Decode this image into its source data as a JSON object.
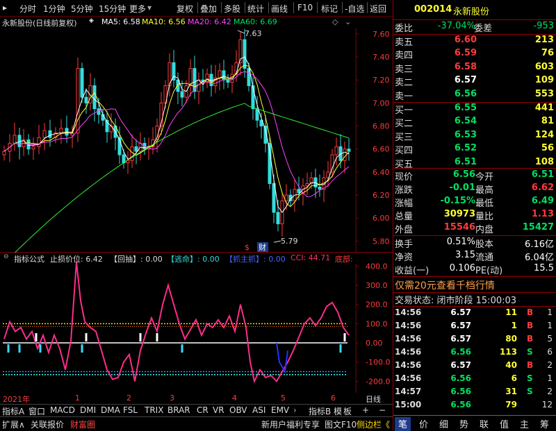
{
  "toolbar": {
    "left_items": [
      "分时",
      "1分钟",
      "5分钟",
      "15分钟",
      "更多"
    ],
    "right_items": [
      "复权",
      "叠加",
      "多股",
      "统计",
      "画线",
      "F10",
      "标记",
      "-自选",
      "返回"
    ]
  },
  "main_legend": {
    "title": "永新股份(日线前复权)",
    "ma5": "MA5: 6.58",
    "ma10": "MA10: 6.56",
    "ma20": "MA20: 6.42",
    "ma60": "MA60: 6.69",
    "high_label": "7.63",
    "low_label": "5.79",
    "marker_money": "$",
    "marker_fin": "财"
  },
  "price_axis": [
    "7.60",
    "7.40",
    "7.20",
    "7.00",
    "6.80",
    "6.60",
    "6.40",
    "6.20",
    "6.00",
    "5.80"
  ],
  "indicator_legend": {
    "name": "指标公式",
    "stop": "止损价位: 6.42",
    "huichou": "【回抽】: 0.00",
    "taoming": "【逃命】: 0.00",
    "dianzhu": "【抓主抓】: 0.00",
    "cci": "CCI: 44.71",
    "dibu": "底部:"
  },
  "indicator_axis": [
    "400.0",
    "300.0",
    "200.0",
    "100.0",
    "0.00",
    "-100.0",
    "-200.0"
  ],
  "time_axis": {
    "labels": [
      "2021年",
      "1",
      "2",
      "3",
      "4",
      "5",
      "6"
    ],
    "right_label": "日线"
  },
  "indicator_tabs": [
    "指标A",
    "窗口",
    "MACD",
    "DMI",
    "DMA",
    "FSL",
    "TRIX",
    "BRAR",
    "CR",
    "VR",
    "OBV",
    "ASI",
    "EMV",
    "指标B",
    "模",
    "板"
  ],
  "bottom_tabs": [
    "扩展∧",
    "关联报价",
    "财富圈",
    "新用户福利专享",
    "图文F10",
    "侧边栏《"
  ],
  "quote": {
    "code": "002014",
    "name": "永新股份",
    "weibi_label": "委比",
    "weibi": "-37.04%",
    "weicha_label": "委差",
    "weicha": "-953",
    "asks": [
      {
        "label": "卖五",
        "price": "6.60",
        "vol": "213"
      },
      {
        "label": "卖四",
        "price": "6.59",
        "vol": "76"
      },
      {
        "label": "卖三",
        "price": "6.58",
        "vol": "603"
      },
      {
        "label": "卖二",
        "price": "6.57",
        "vol": "109"
      },
      {
        "label": "卖一",
        "price": "6.56",
        "vol": "553"
      }
    ],
    "bids": [
      {
        "label": "买一",
        "price": "6.55",
        "vol": "441"
      },
      {
        "label": "买二",
        "price": "6.54",
        "vol": "81"
      },
      {
        "label": "买三",
        "price": "6.53",
        "vol": "124"
      },
      {
        "label": "买四",
        "price": "6.52",
        "vol": "56"
      },
      {
        "label": "买五",
        "price": "6.51",
        "vol": "108"
      }
    ],
    "stats": [
      {
        "l1": "现价",
        "v1": "6.56",
        "l2": "今开",
        "v2": "6.51"
      },
      {
        "l1": "涨跌",
        "v1": "-0.01",
        "l2": "最高",
        "v2": "6.62"
      },
      {
        "l1": "涨幅",
        "v1": "-0.15%",
        "l2": "最低",
        "v2": "6.49"
      },
      {
        "l1": "总量",
        "v1": "30973",
        "l2": "量比",
        "v2": "1.13"
      },
      {
        "l1": "外盘",
        "v1": "15546",
        "l2": "内盘",
        "v2": "15427"
      }
    ],
    "stats2": [
      {
        "l1": "换手",
        "v1": "0.51%",
        "l2": "股本",
        "v2": "6.16亿"
      },
      {
        "l1": "净资",
        "v1": "3.15",
        "l2": "流通",
        "v2": "6.04亿"
      },
      {
        "l1": "收益(一)",
        "v1": "0.106",
        "l2": "PE(动)",
        "v2": "15.5"
      }
    ],
    "promo": "仅需20元查看千档行情",
    "trade_status": "交易状态: 闭市阶段 15:00:03",
    "trades": [
      {
        "time": "14:56",
        "price": "6.57",
        "vol": "11",
        "side": "B",
        "n": "1"
      },
      {
        "time": "14:56",
        "price": "6.57",
        "vol": "1",
        "side": "B",
        "n": "1"
      },
      {
        "time": "14:56",
        "price": "6.57",
        "vol": "80",
        "side": "B",
        "n": "5"
      },
      {
        "time": "14:56",
        "price": "6.56",
        "vol": "113",
        "side": "S",
        "n": "6"
      },
      {
        "time": "14:56",
        "price": "6.57",
        "vol": "40",
        "side": "B",
        "n": "2"
      },
      {
        "time": "14:56",
        "price": "6.56",
        "vol": "6",
        "side": "S",
        "n": "1"
      },
      {
        "time": "14:57",
        "price": "6.56",
        "vol": "31",
        "side": "S",
        "n": "2"
      },
      {
        "time": "15:00",
        "price": "6.56",
        "vol": "79",
        "side": "",
        "n": "12"
      }
    ],
    "nav": [
      "笔",
      "价",
      "细",
      "势",
      "联",
      "值",
      "主",
      "筹"
    ]
  },
  "colors": {
    "up": "#ff3b3b",
    "down": "#33dddd",
    "ma5": "#ffffff",
    "ma10": "#ffff33",
    "ma20": "#ff44ff",
    "ma60": "#33ee33",
    "cci": "#ff2d8a"
  }
}
